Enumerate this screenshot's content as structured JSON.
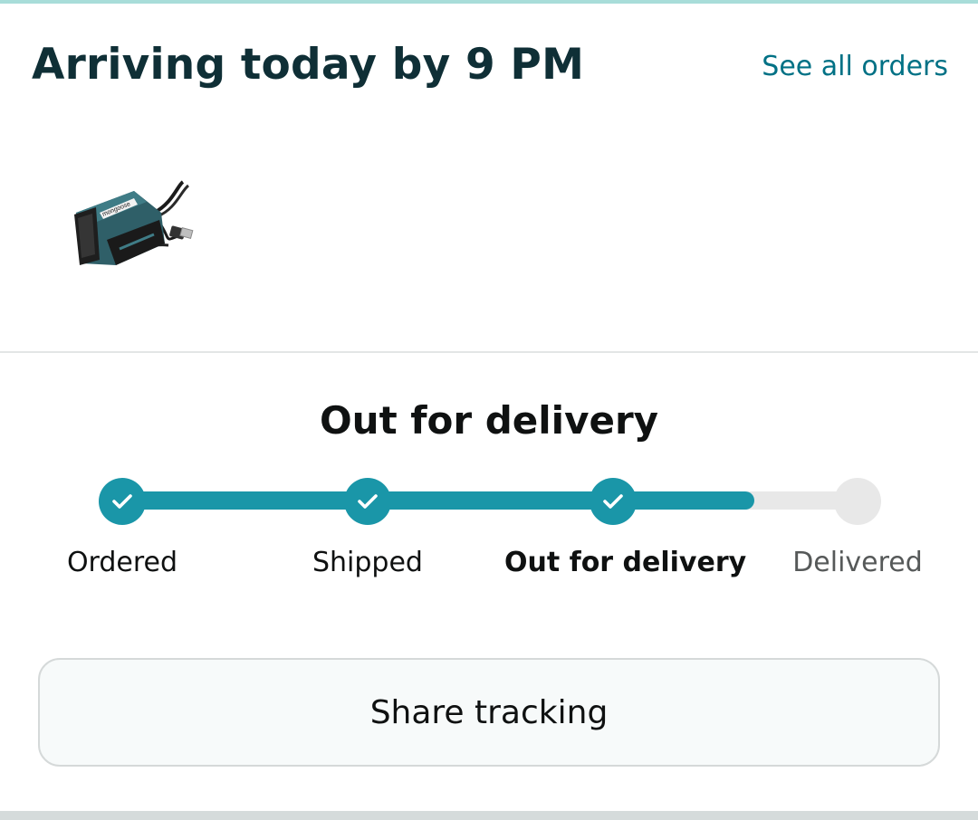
{
  "header": {
    "title": "Arriving today by 9 PM",
    "see_all_label": "See all orders"
  },
  "product": {
    "image_icon": "obd-usb-cable-product-image",
    "brand_text": "mongoose"
  },
  "tracking": {
    "status_title": "Out for delivery",
    "progress_fraction": 0.86,
    "steps": [
      {
        "label": "Ordered",
        "state": "done"
      },
      {
        "label": "Shipped",
        "state": "done"
      },
      {
        "label": "Out for delivery",
        "state": "current"
      },
      {
        "label": "Delivered",
        "state": "pending"
      }
    ]
  },
  "actions": {
    "share_label": "Share tracking"
  },
  "colors": {
    "accent": "#1a96a8",
    "link": "#007185",
    "title": "#0f2f36",
    "inactive": "#e8e8e8"
  }
}
